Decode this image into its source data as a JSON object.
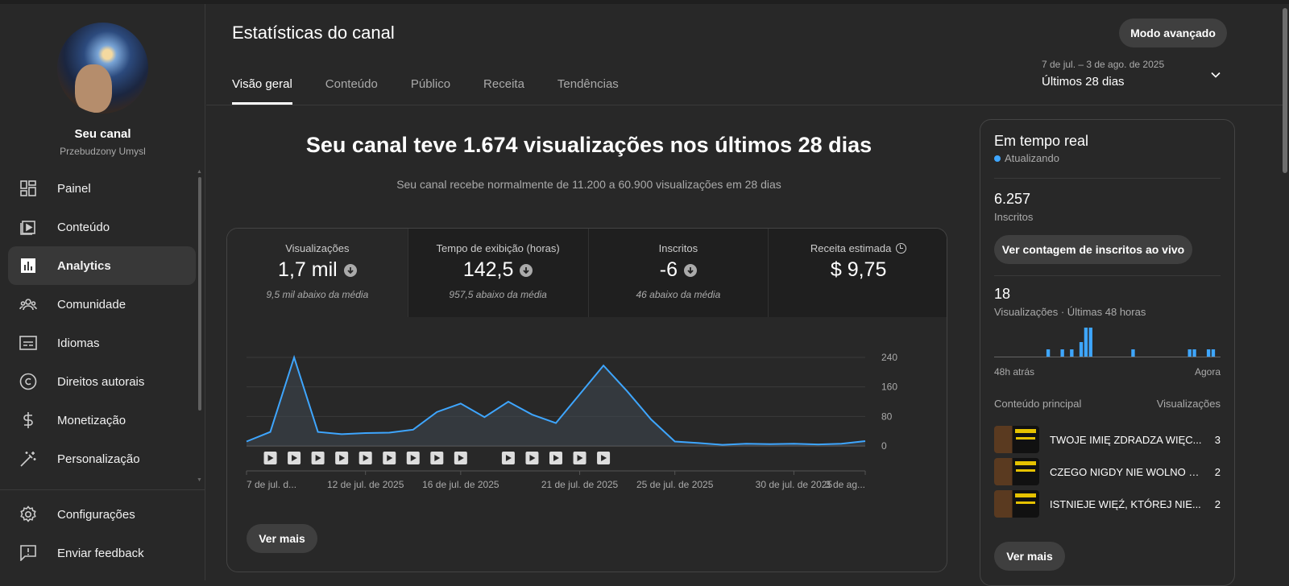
{
  "sidebar": {
    "channel_name": "Seu canal",
    "channel_handle": "Przebudzony Umysl",
    "items": [
      {
        "label": "Painel",
        "icon": "dashboard-icon"
      },
      {
        "label": "Conteúdo",
        "icon": "content-icon"
      },
      {
        "label": "Analytics",
        "icon": "analytics-icon",
        "active": true
      },
      {
        "label": "Comunidade",
        "icon": "community-icon"
      },
      {
        "label": "Idiomas",
        "icon": "subtitles-icon"
      },
      {
        "label": "Direitos autorais",
        "icon": "copyright-icon"
      },
      {
        "label": "Monetização",
        "icon": "dollar-icon"
      },
      {
        "label": "Personalização",
        "icon": "magic-wand-icon"
      }
    ],
    "bottom_items": [
      {
        "label": "Configurações",
        "icon": "gear-icon"
      },
      {
        "label": "Enviar feedback",
        "icon": "feedback-icon"
      }
    ]
  },
  "header": {
    "title": "Estatísticas do canal",
    "advanced_button": "Modo avançado",
    "tabs": [
      "Visão geral",
      "Conteúdo",
      "Público",
      "Receita",
      "Tendências"
    ],
    "date_range": "7 de jul. – 3 de ago. de 2025",
    "date_label": "Últimos 28 dias"
  },
  "summary": {
    "headline": "Seu canal teve 1.674 visualizações nos últimos 28 dias",
    "subline": "Seu canal recebe normalmente de 11.200 a 60.900 visualizações em 28 dias"
  },
  "metrics": [
    {
      "title": "Visualizações",
      "value": "1,7 mil",
      "note": "9,5 mil abaixo da média",
      "down": true
    },
    {
      "title": "Tempo de exibição (horas)",
      "value": "142,5",
      "note": "957,5 abaixo da média",
      "down": true
    },
    {
      "title": "Inscritos",
      "value": "-6",
      "note": "46 abaixo da média",
      "down": true
    },
    {
      "title": "Receita estimada",
      "value": "$ 9,75",
      "note": "",
      "down": false
    }
  ],
  "chart_data": {
    "type": "area",
    "series": [
      {
        "values": [
          12,
          38,
          240,
          38,
          32,
          35,
          36,
          44,
          92,
          115,
          78,
          120,
          85,
          62,
          140,
          218,
          148,
          72,
          12,
          8,
          3,
          6,
          5,
          6,
          4,
          6,
          13
        ]
      }
    ],
    "x_tick_labels": [
      "7 de jul. d...",
      "12 de jul. de 2025",
      "16 de jul. de 2025",
      "21 de jul. de 2025",
      "25 de jul. de 2025",
      "30 de jul. de 2025",
      "3 de ag..."
    ],
    "y_ticks": [
      0,
      80,
      160,
      240
    ],
    "ylim": [
      0,
      240
    ],
    "video_marker_days": [
      1,
      2,
      3,
      4,
      5,
      6,
      7,
      8,
      9,
      11,
      12,
      13,
      14,
      15
    ],
    "colors": {
      "line": "#3ea6ff",
      "fill": "#3e4750",
      "grid": "#3a3a3a"
    }
  },
  "more_button": "Ver mais",
  "realtime": {
    "title": "Em tempo real",
    "updating": "Atualizando",
    "subs_value": "6.257",
    "subs_label": "Inscritos",
    "live_button": "Ver contagem de inscritos ao vivo",
    "views_value": "18",
    "views_label": "Visualizações · Últimas 48 horas",
    "hourly_views": [
      0,
      0,
      0,
      0,
      0,
      0,
      0,
      0,
      0,
      0,
      0,
      1,
      0,
      0,
      1,
      0,
      1,
      0,
      2,
      4,
      4,
      0,
      0,
      0,
      0,
      0,
      0,
      0,
      0,
      1,
      0,
      0,
      0,
      0,
      0,
      0,
      0,
      0,
      0,
      0,
      0,
      1,
      1,
      0,
      0,
      1,
      1,
      0
    ],
    "ago_label": "48h atrás",
    "now_label": "Agora",
    "top_content_label": "Conteúdo principal",
    "top_views_label": "Visualizações",
    "top_content": [
      {
        "title": "TWOJE IMIĘ ZDRADZA WIĘC...",
        "views": "3"
      },
      {
        "title": "CZEGO NIGDY NIE WOLNO R...",
        "views": "2"
      },
      {
        "title": "ISTNIEJE WIĘŹ, KTÓREJ NIE...",
        "views": "2"
      }
    ],
    "more_button": "Ver mais"
  }
}
